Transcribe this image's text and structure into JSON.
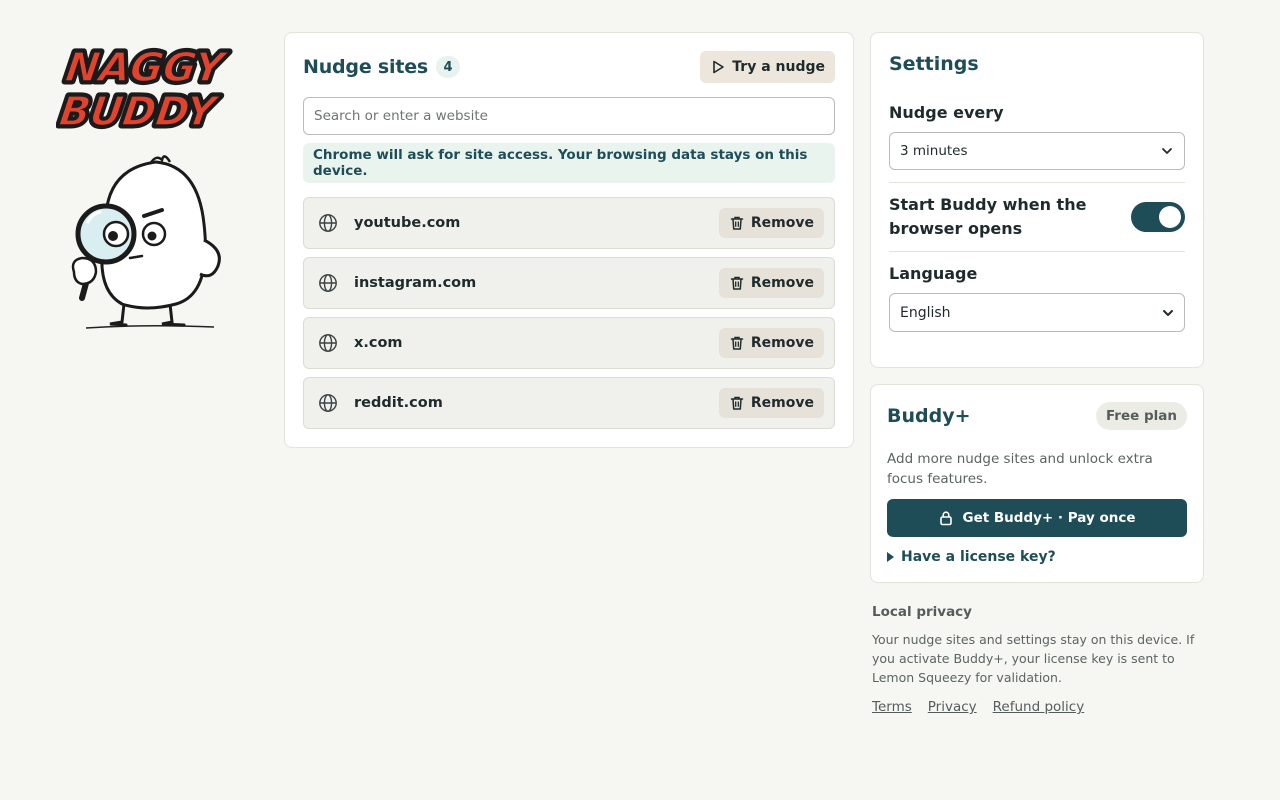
{
  "brand": {
    "logo_line1": "NAGGY",
    "logo_line2": "BUDDY",
    "mascot": "buddy-with-magnifying-glass"
  },
  "sites": {
    "title": "Nudge sites",
    "count": "4",
    "try_label": "Try a nudge",
    "search_placeholder": "Search or enter a website",
    "notice": "Chrome will ask for site access. Your browsing data stays on this device.",
    "remove_label": "Remove",
    "items": [
      {
        "domain": "youtube.com"
      },
      {
        "domain": "instagram.com"
      },
      {
        "domain": "x.com"
      },
      {
        "domain": "reddit.com"
      }
    ]
  },
  "settings": {
    "title": "Settings",
    "nudge_label": "Nudge every",
    "nudge_value": "3 minutes",
    "startup_label": "Start Buddy when the browser opens",
    "startup_enabled": true,
    "language_label": "Language",
    "language_value": "English"
  },
  "plus": {
    "title": "Buddy+",
    "plan": "Free plan",
    "description": "Add more nudge sites and unlock extra focus features.",
    "buy_label": "Get Buddy+ · Pay once",
    "license_label": "Have a license key?"
  },
  "privacy": {
    "title": "Local privacy",
    "text": "Your nudge sites and settings stay on this device. If you activate Buddy+, your license key is sent to Lemon Squeezy for validation.",
    "links": {
      "terms": "Terms",
      "privacy": "Privacy",
      "refund": "Refund policy"
    }
  },
  "colors": {
    "accent": "#1f4d57",
    "logo_red": "#e0432e",
    "background": "#f6f6f2"
  },
  "icons": {
    "site": "globe-icon",
    "remove": "trash-icon",
    "try": "play-icon",
    "buy": "lock-icon",
    "select": "chevron-down-icon"
  }
}
